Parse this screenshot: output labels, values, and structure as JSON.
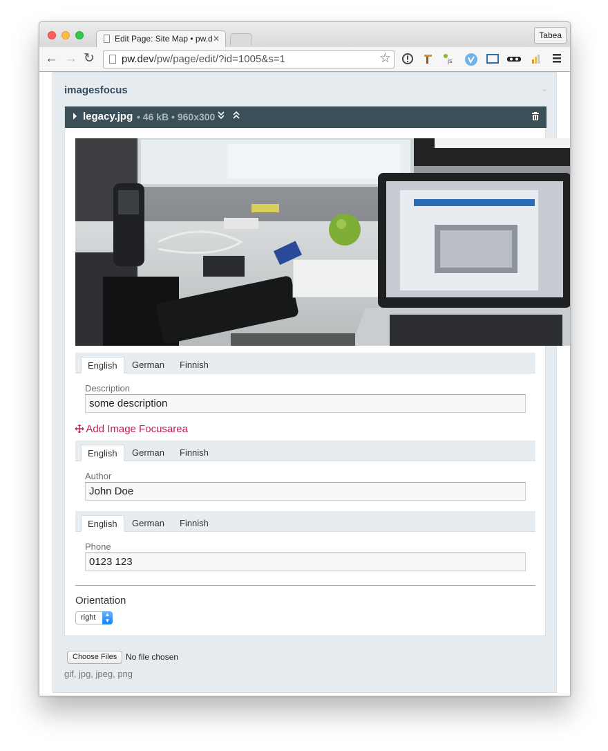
{
  "browser": {
    "tab_title": "Edit Page: Site Map • pw.dev",
    "tab_close": "✕",
    "profile_name": "Tabea",
    "url_host": "pw.dev",
    "url_path": "/pw/page/edit/?id=1005&s=1"
  },
  "field": {
    "title": "imagesfocus"
  },
  "image": {
    "filename": "legacy.jpg",
    "meta": "• 46 kB • 960x300"
  },
  "description": {
    "tabs": [
      "English",
      "German",
      "Finnish"
    ],
    "label": "Description",
    "value": "some description"
  },
  "focus_link": "Add Image Focusarea",
  "author": {
    "tabs": [
      "English",
      "German",
      "Finnish"
    ],
    "label": "Author",
    "value": "John Doe"
  },
  "phone": {
    "tabs": [
      "English",
      "German",
      "Finnish"
    ],
    "label": "Phone",
    "value": "0123 123"
  },
  "orientation": {
    "label": "Orientation",
    "selected": "right"
  },
  "upload": {
    "button_label": "Choose Files",
    "status": "No file chosen",
    "extensions": "gif, jpg, jpeg, png"
  },
  "colors": {
    "header_bar": "#3a4f57",
    "accent_link": "#c2185b",
    "field_title": "#354b60"
  }
}
